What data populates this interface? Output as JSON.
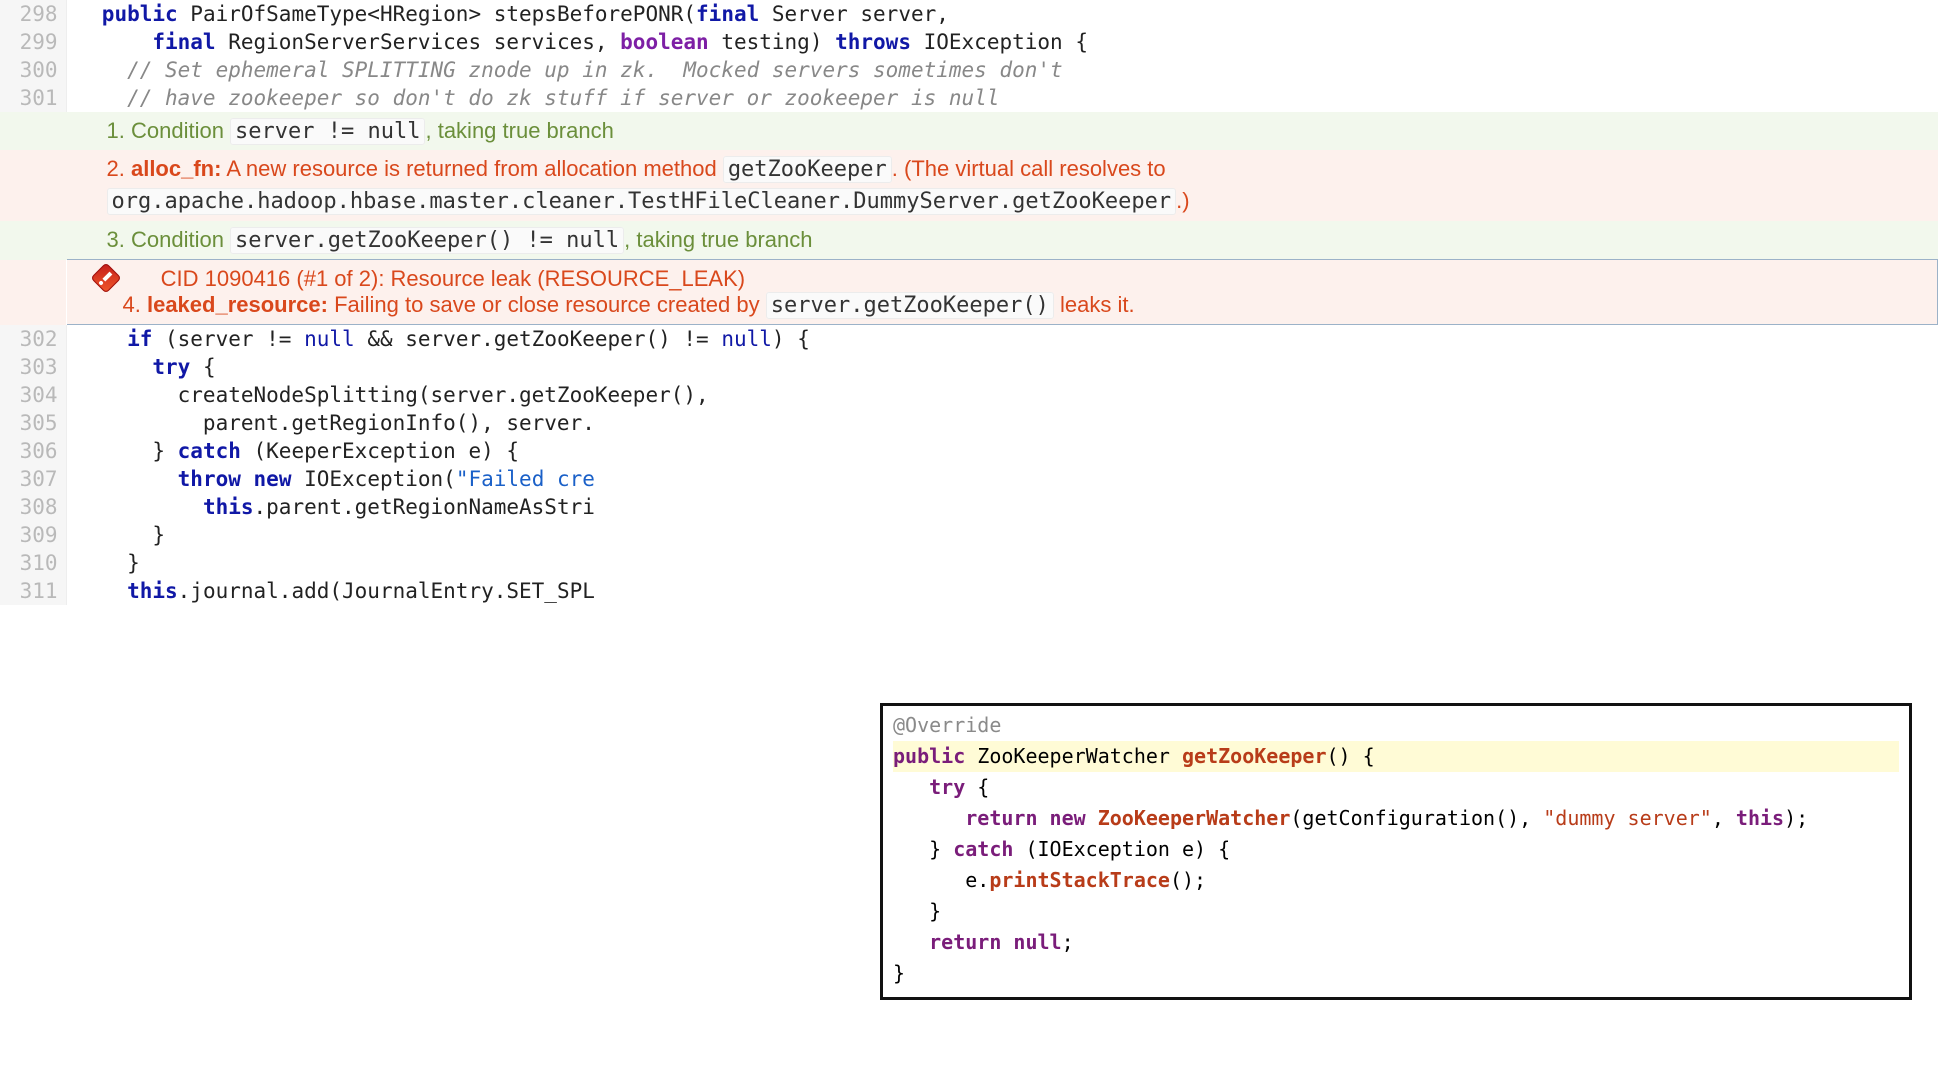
{
  "lines": {
    "298": {
      "num": "298"
    },
    "299": {
      "num": "299"
    },
    "300": {
      "num": "300"
    },
    "301": {
      "num": "301"
    },
    "302": {
      "num": "302"
    },
    "303": {
      "num": "303"
    },
    "304": {
      "num": "304"
    },
    "305": {
      "num": "305"
    },
    "306": {
      "num": "306"
    },
    "307": {
      "num": "307"
    },
    "308": {
      "num": "308"
    },
    "309": {
      "num": "309"
    },
    "310": {
      "num": "310"
    },
    "311": {
      "num": "311"
    }
  },
  "code": {
    "l298_kw1": "public",
    "l298_type": " PairOfSameType<HRegion> stepsBeforePONR(",
    "l298_kw2": "final",
    "l298_rest": " Server server,",
    "l299_indent": "      ",
    "l299_kw1": "final",
    "l299_mid": " RegionServerServices services, ",
    "l299_kw2": "boolean",
    "l299_mid2": " testing) ",
    "l299_kw3": "throws",
    "l299_rest": " IOException {",
    "l300": "    // Set ephemeral SPLITTING znode up in zk.  Mocked servers sometimes don't",
    "l301": "    // have zookeeper so don't do zk stuff if server or zookeeper is null",
    "l302_indent": "    ",
    "l302_kw": "if",
    "l302_a": " (server != ",
    "l302_null1": "null",
    "l302_b": " && server.getZooKeeper() != ",
    "l302_null2": "null",
    "l302_c": ") {",
    "l303_indent": "      ",
    "l303_kw": "try",
    "l303_rest": " {",
    "l304": "        createNodeSplitting(server.getZooKeeper(),",
    "l305": "          parent.getRegionInfo(), server.",
    "l306_indent": "      } ",
    "l306_kw": "catch",
    "l306_rest": " (KeeperException e) {",
    "l307_indent": "        ",
    "l307_kw1": "throw",
    "l307_sp": " ",
    "l307_kw2": "new",
    "l307_mid": " IOException(",
    "l307_str": "\"Failed cre",
    "l308_indent": "          ",
    "l308_kw": "this",
    "l308_rest": ".parent.getRegionNameAsStri",
    "l309": "      }",
    "l310": "    }",
    "l311_indent": "    ",
    "l311_kw": "this",
    "l311_rest": ".journal.add(JournalEntry.SET_SPL"
  },
  "annot": {
    "a1_num": "1.",
    "a1_pre": " Condition ",
    "a1_code": "server != null",
    "a1_post": ", taking true branch",
    "a2_num": "2.",
    "a2_strong": " alloc_fn:",
    "a2_pre": " A new resource is returned from allocation method ",
    "a2_code": "getZooKeeper",
    "a2_post": ". (The virtual call resolves to ",
    "a2_code2": "org.apache.hadoop.hbase.master.cleaner.TestHFileCleaner.DummyServer.getZooKeeper",
    "a2_post2": ".)",
    "a3_num": "3.",
    "a3_pre": " Condition ",
    "a3_code": "server.getZooKeeper() != null",
    "a3_post": ", taking true branch",
    "cid_title": "CID 1090416 (#1 of 2): Resource leak (RESOURCE_LEAK)",
    "a4_num": "4.",
    "a4_strong": " leaked_resource:",
    "a4_pre": " Failing to save or close resource created by ",
    "a4_code": "server.getZooKeeper()",
    "a4_post": " leaks it."
  },
  "popup": {
    "l1_ann": "@Override",
    "l2_kw": "public",
    "l2_type": " ZooKeeperWatcher ",
    "l2_name": "getZooKeeper",
    "l2_rest": "() {",
    "l3_indent": "   ",
    "l3_kw": "try",
    "l3_rest": " {",
    "l4_indent": "      ",
    "l4_kw1": "return",
    "l4_sp": " ",
    "l4_kw2": "new",
    "l4_mid": " ",
    "l4_name": "ZooKeeperWatcher",
    "l4_a": "(getConfiguration(), ",
    "l4_str": "\"dummy server\"",
    "l4_b": ", ",
    "l4_kw3": "this",
    "l4_c": ");",
    "l5_indent": "   } ",
    "l5_kw": "catch",
    "l5_rest": " (IOException e) {",
    "l6_indent": "      e.",
    "l6_name": "printStackTrace",
    "l6_rest": "();",
    "l7": "   }",
    "l8_indent": "   ",
    "l8_kw": "return",
    "l8_sp": " ",
    "l8_null": "null",
    "l8_rest": ";",
    "l9": "}"
  }
}
